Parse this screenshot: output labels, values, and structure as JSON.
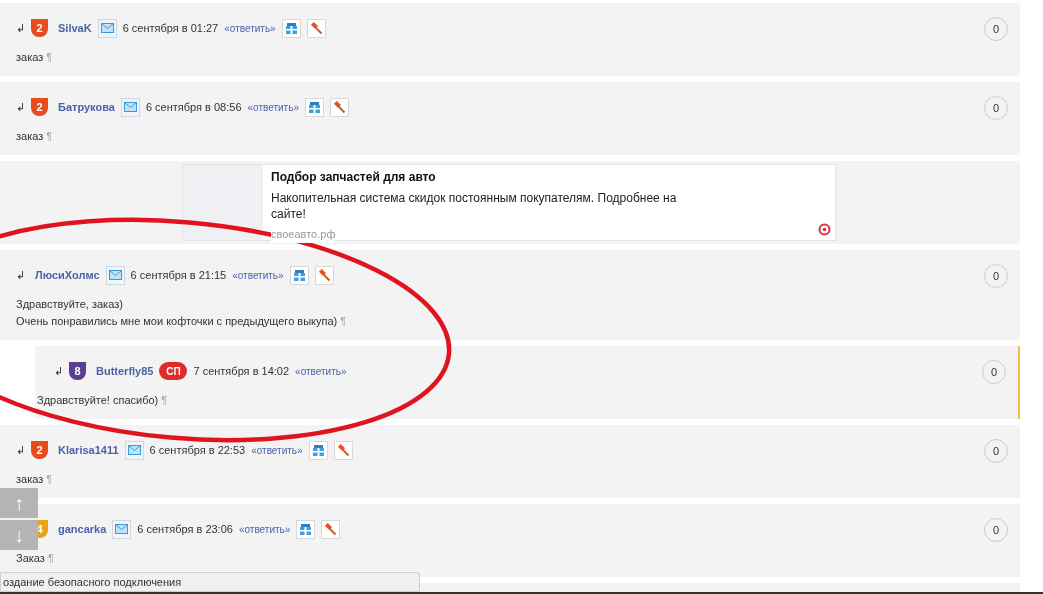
{
  "entries": [
    {
      "kind": "comment",
      "rank": "2",
      "author": "SilvaK",
      "mail": true,
      "date": "6 сентября в 01:27",
      "reply": "«ответить»",
      "tools": true,
      "lines": [
        "заказ"
      ],
      "pilcrow": "¶",
      "votes": "0",
      "nested": false,
      "highlighted": false
    },
    {
      "kind": "comment",
      "rank": "2",
      "author": "Батрукова",
      "mail": true,
      "date": "6 сентября в 08:56",
      "reply": "«ответить»",
      "tools": true,
      "lines": [
        "заказ"
      ],
      "pilcrow": "¶",
      "votes": "0",
      "nested": false,
      "highlighted": false
    },
    {
      "kind": "ad",
      "title": "Подбор запчастей для авто",
      "text": "Накопительная система скидок постоянным покупателям. Подробнее на сайте!",
      "domain": "своеавто.рф"
    },
    {
      "kind": "comment",
      "author": "ЛюсиХолмс",
      "mail": true,
      "date": "6 сентября в 21:15",
      "reply": "«ответить»",
      "tools": true,
      "lines": [
        "Здравствуйте, заказ)",
        "Очень понравились мне мои кофточки с предыдущего выкупа)"
      ],
      "pilcrow": "¶",
      "votes": "0",
      "nested": false,
      "highlighted": false
    },
    {
      "kind": "comment",
      "rank": "8",
      "author": "Butterfly85",
      "award": "СП",
      "mail": false,
      "date": "7 сентября в 14:02",
      "reply": "«ответить»",
      "tools": false,
      "lines": [
        "Здравствуйте! спасибо)"
      ],
      "pilcrow": "¶",
      "votes": "0",
      "nested": true,
      "highlighted": true
    },
    {
      "kind": "comment",
      "rank": "2",
      "author": "Klarisa1411",
      "mail": true,
      "date": "6 сентября в 22:53",
      "reply": "«ответить»",
      "tools": true,
      "lines": [
        "заказ"
      ],
      "pilcrow": "¶",
      "votes": "0",
      "nested": false,
      "highlighted": false
    },
    {
      "kind": "comment",
      "rank": "4",
      "author": "gancarka",
      "mail": true,
      "date": "6 сентября в 23:06",
      "reply": "«ответить»",
      "tools": true,
      "lines": [
        "Заказ"
      ],
      "pilcrow": "¶",
      "votes": "0",
      "nested": false,
      "highlighted": false
    }
  ],
  "reply_arrow": "↲",
  "scroll_buttons": [
    "↑",
    "↓"
  ],
  "status_bar": "оздание безопасного подключения"
}
